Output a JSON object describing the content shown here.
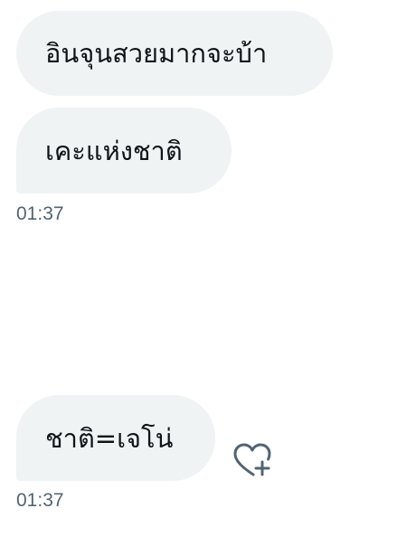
{
  "messages": [
    {
      "text": "อินจุนสวยมากจะบ้า"
    },
    {
      "text": "เคะแห่งชาติ",
      "timestamp": "01:37"
    },
    {
      "text": "ชาติ=เจโน่",
      "timestamp": "01:37"
    }
  ],
  "icons": {
    "reaction": "heart-plus-icon"
  },
  "colors": {
    "bubble_bg": "#eff3f4",
    "text": "#0f1419",
    "timestamp": "#536471"
  }
}
